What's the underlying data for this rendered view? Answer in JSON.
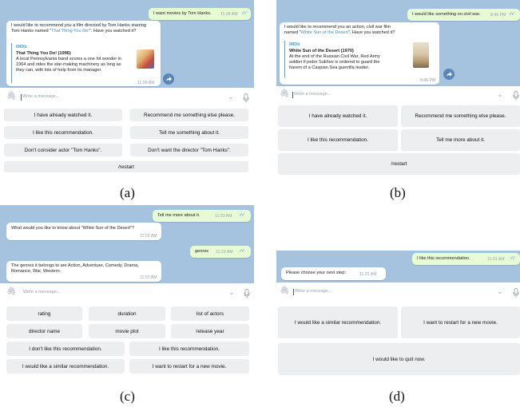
{
  "labels": {
    "a": "(a)",
    "b": "(b)",
    "c": "(c)",
    "d": "(d)"
  },
  "composer_placeholder": "Write a message...",
  "panel_a": {
    "user_msg": "I want movies by Tom Hanks.",
    "user_time": "11:28 AM",
    "bot_msg_pre": "I would like to recommend you a film directed by Tom Hanks starring Tom Hanks named “",
    "bot_msg_link": "That Thing You Do!",
    "bot_msg_post": "”. Have you watched it?",
    "preview_site": "IMDb",
    "preview_title": "That Thing You Do! (1996)",
    "preview_desc": "A local Pennsylvania band scores a one hit wonder in 1964 and rides the star-making machinery as long as they can, with lots of help from its manager.",
    "bot_time": "11:28 AM",
    "buttons": [
      "I have already watched it.",
      "Recommend me something else please.",
      "I like this recommendation.",
      "Tell me something about it.",
      "Don't consider actor \"Tom Hanks\".",
      "Don't want the director \"Tom Hanks\".",
      "/restart"
    ]
  },
  "panel_b": {
    "user_msg": "I would like something on civil war.",
    "user_time": "8:46 PM",
    "bot_msg_pre": "I would like to recommend you an action, civil war film named “",
    "bot_msg_link": "White Sun of the Desert",
    "bot_msg_post": "”. Have you watched it?",
    "preview_site": "IMDb",
    "preview_title": "White Sun of the Desert (1970)",
    "preview_desc": "At the end of the Russian Civil War, Red Army soldier Fyodor Sukhov is ordered to guard the harem of a Caspian Sea guerrilla leader.",
    "bot_time": "8:46 PM",
    "buttons": [
      "I have already watched it.",
      "Recommend me something else please.",
      "I like this recommendation.",
      "Tell me more about it.",
      "/restart"
    ]
  },
  "panel_c": {
    "user_msg1": "Tell me more about it.",
    "user_time1": "11:23 AM",
    "bot_msg1": "What would you like to know about \"White Sun of the Desert\"?",
    "bot_time1": "11:23 AM",
    "user_msg2": "genres",
    "user_time2": "11:23 AM",
    "bot_msg2": "The genres it belongs to are Action, Adventure, Comedy, Drama, Romance, War, Western.",
    "bot_time2": "11:23 AM",
    "buttons": [
      "rating",
      "duration",
      "list of actors",
      "director name",
      "movie plot",
      "release year",
      "I don't like this recommendation.",
      "I like this recommendation.",
      "I would like a similar recommendation.",
      "I want to restart for a new movie."
    ]
  },
  "panel_d": {
    "user_msg": "I like this recommendation.",
    "user_time": "11:31 AM",
    "bot_msg": "Please choose your next step:",
    "bot_time": "11:31 AM",
    "buttons": [
      "I would like a similar recommendation.",
      "I want to restart for a new movie.",
      "I would like to quit now."
    ]
  },
  "colors": {
    "chat_bg": "#a5c3df",
    "outgoing": "#e7fbd4",
    "incoming": "#ffffff",
    "button": "#eceef0",
    "check": "#4ea4f6",
    "link": "#3a8fd6"
  }
}
